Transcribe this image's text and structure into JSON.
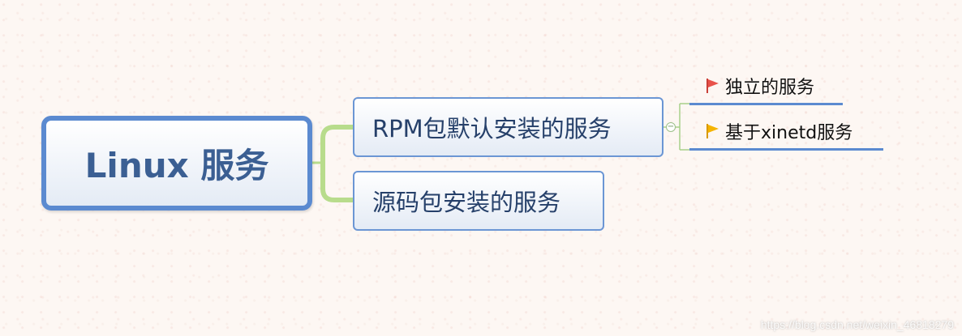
{
  "root": {
    "label": "Linux 服务"
  },
  "branches": [
    {
      "label": "RPM包默认安装的服务"
    },
    {
      "label": "源码包安装的服务"
    }
  ],
  "leaves": [
    {
      "label": "独立的服务",
      "flag_color": "#e8524a"
    },
    {
      "label": "基于xinetd服务",
      "flag_color": "#f5b400"
    }
  ],
  "collapse_symbol": "−",
  "watermark": "https://blog.csdn.net/weixin_46818279",
  "colors": {
    "node_border": "#5b8ad0",
    "connector_green": "#b8dc8c"
  }
}
